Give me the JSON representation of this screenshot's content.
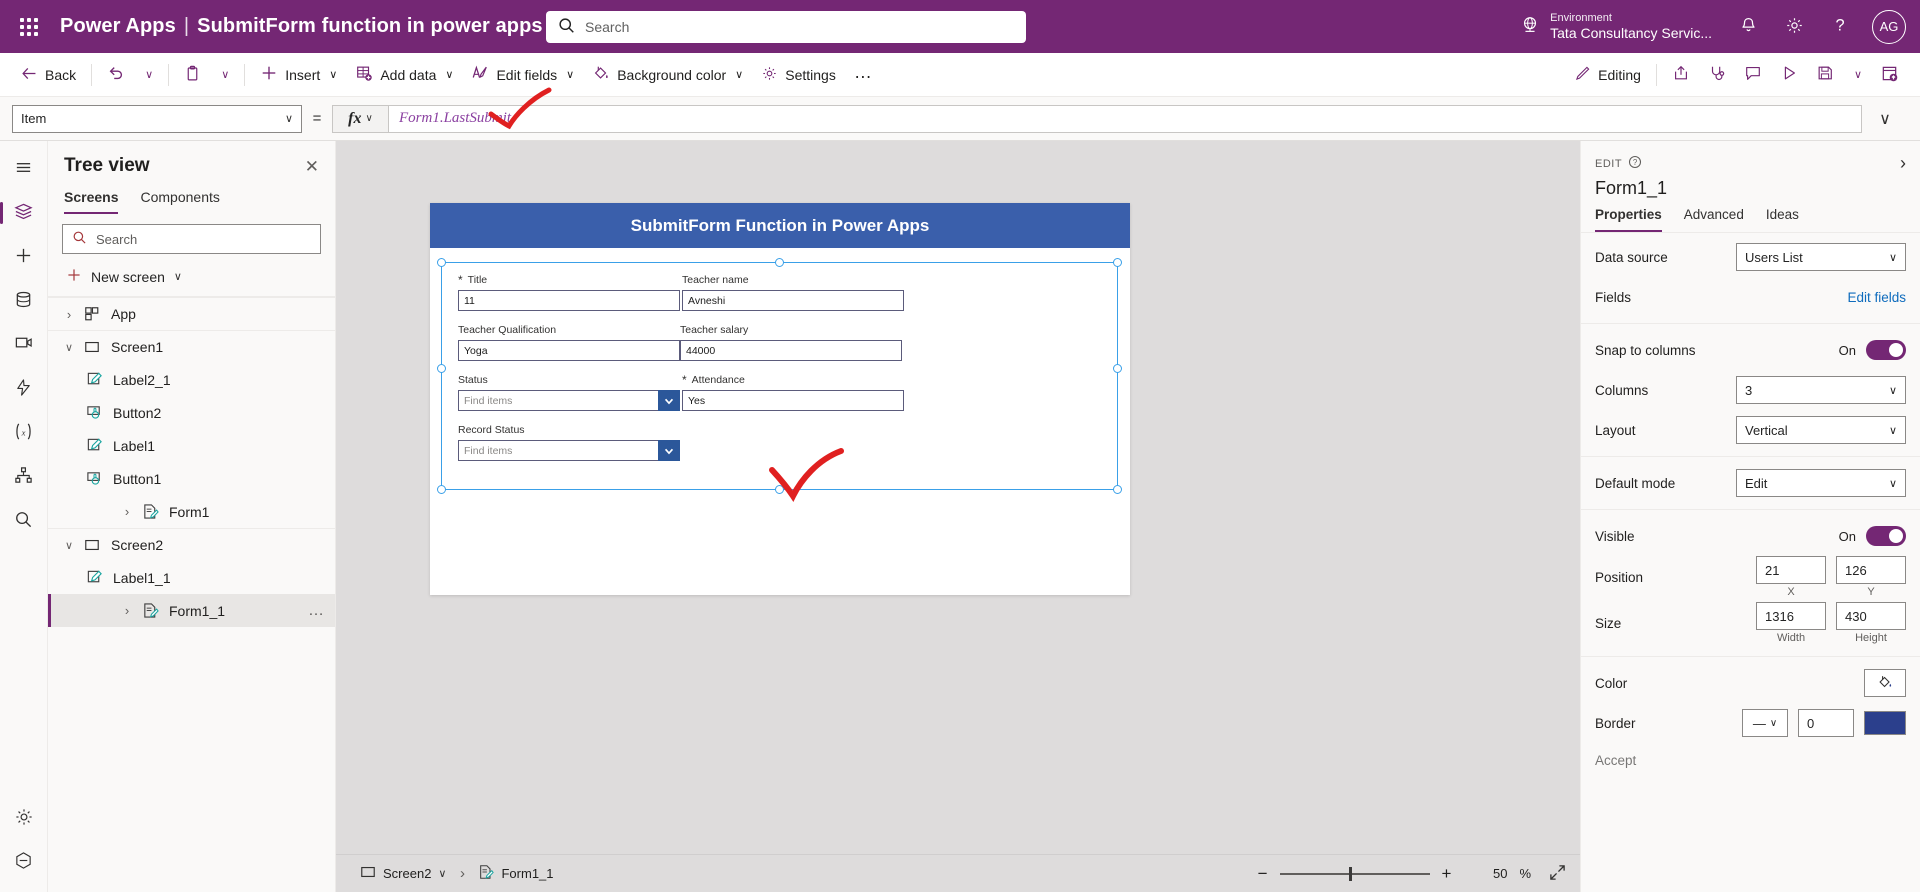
{
  "topbar": {
    "waffle_label": "App launcher",
    "brand": "Power Apps",
    "separator": "|",
    "doc_title": "SubmitForm function in power apps",
    "search_placeholder": "Search",
    "environment_label": "Environment",
    "environment_value": "Tata Consultancy Servic...",
    "notifications_label": "Notifications",
    "settings_label": "Settings",
    "help_label": "Help",
    "avatar_initials": "AG"
  },
  "commandbar": {
    "back": "Back",
    "undo": "Undo",
    "undo_chevron": "∨",
    "paste": "Paste",
    "paste_chevron": "∨",
    "insert": "Insert",
    "insert_chevron": "∨",
    "add_data": "Add data",
    "add_data_chevron": "∨",
    "edit_fields": "Edit fields",
    "edit_fields_chevron": "∨",
    "background_color": "Background color",
    "background_color_chevron": "∨",
    "settings": "Settings",
    "more": "…",
    "editing": "Editing",
    "share": "Share",
    "checker": "App checker",
    "comments": "Comments",
    "preview": "Preview the app",
    "save": "Save",
    "save_chevron": "∨",
    "publish": "Publish"
  },
  "formulabar": {
    "property_selected": "Item",
    "property_chevron": "∨",
    "equals": "=",
    "fx": "fx",
    "fx_chevron": "∨",
    "formula": "Form1.LastSubmit",
    "expand_chevron": "∨"
  },
  "rail": {
    "items": [
      {
        "name": "hamburger-icon",
        "label": "Menu"
      },
      {
        "name": "tree-view-icon",
        "label": "Tree view"
      },
      {
        "name": "insert-icon",
        "label": "Insert"
      },
      {
        "name": "data-icon",
        "label": "Data"
      },
      {
        "name": "media-icon",
        "label": "Media"
      },
      {
        "name": "power-automate-icon",
        "label": "Power Automate"
      },
      {
        "name": "variables-icon",
        "label": "Variables"
      },
      {
        "name": "components-icon",
        "label": "Components"
      },
      {
        "name": "search-icon",
        "label": "Search"
      },
      {
        "name": "app-settings-icon",
        "label": "Settings"
      },
      {
        "name": "advanced-tools-icon",
        "label": "Advanced tools"
      }
    ]
  },
  "treeview": {
    "title": "Tree view",
    "close_label": "Close",
    "tabs": [
      {
        "label": "Screens",
        "active": true
      },
      {
        "label": "Components",
        "active": false
      }
    ],
    "search_placeholder": "Search",
    "new_screen": "New screen",
    "new_screen_chevron": "∨",
    "items": [
      {
        "label": "App",
        "icon": "app-icon",
        "depth": 0,
        "twisty": "›",
        "selected": false,
        "group_top": true
      },
      {
        "label": "Screen1",
        "icon": "screen-icon",
        "depth": 0,
        "twisty": "∨",
        "selected": false,
        "group_top": true
      },
      {
        "label": "Label2_1",
        "icon": "label-icon",
        "depth": 2,
        "twisty": "",
        "selected": false
      },
      {
        "label": "Button2",
        "icon": "button-icon",
        "depth": 2,
        "twisty": "",
        "selected": false
      },
      {
        "label": "Label1",
        "icon": "label-icon",
        "depth": 2,
        "twisty": "",
        "selected": false
      },
      {
        "label": "Button1",
        "icon": "button-icon",
        "depth": 2,
        "twisty": "",
        "selected": false
      },
      {
        "label": "Form1",
        "icon": "form-icon",
        "depth": 1,
        "twisty": "›",
        "selected": false
      },
      {
        "label": "Screen2",
        "icon": "screen-icon",
        "depth": 0,
        "twisty": "∨",
        "selected": false
      },
      {
        "label": "Label1_1",
        "icon": "label-icon",
        "depth": 2,
        "twisty": "",
        "selected": false
      },
      {
        "label": "Form1_1",
        "icon": "form-icon",
        "depth": 1,
        "twisty": "›",
        "selected": true,
        "dots": "…"
      }
    ]
  },
  "canvas": {
    "app_title": "SubmitForm Function in Power Apps",
    "title_bg": "#3a5fab",
    "selection_color": "#3aa0e8",
    "annotation_color": "#e02020",
    "fields": [
      {
        "label": "Title",
        "required": true,
        "type": "text",
        "value": "11"
      },
      {
        "label": "Teacher name",
        "required": false,
        "type": "text",
        "value": "Avneshi"
      },
      {
        "label": "Teacher Qualification",
        "required": false,
        "type": "text",
        "value": "Yoga"
      },
      {
        "label": "Teacher salary",
        "required": false,
        "type": "text",
        "value": "44000"
      },
      {
        "label": "Status",
        "required": false,
        "type": "combo",
        "value": "Find items"
      },
      {
        "label": "Attendance",
        "required": true,
        "type": "text",
        "value": "Yes"
      },
      {
        "label": "Record Status",
        "required": false,
        "type": "combo",
        "value": "Find items"
      }
    ]
  },
  "statusbar": {
    "screen_name": "Screen2",
    "screen_chevron": "∨",
    "breadcrumb_sep": "›",
    "control_name": "Form1_1",
    "zoom_out": "−",
    "zoom_in": "+",
    "zoom_value": "50",
    "zoom_unit": "%",
    "fit_label": "Fit to window"
  },
  "properties": {
    "edit_label": "EDIT",
    "help_label": "?",
    "expand_label": "›",
    "control_name": "Form1_1",
    "tabs": [
      {
        "label": "Properties",
        "active": true
      },
      {
        "label": "Advanced",
        "active": false
      },
      {
        "label": "Ideas",
        "active": false
      }
    ],
    "rows": {
      "data_source_label": "Data source",
      "data_source_value": "Users List",
      "fields_label": "Fields",
      "fields_action": "Edit fields",
      "snap_label": "Snap to columns",
      "snap_state": "On",
      "columns_label": "Columns",
      "columns_value": "3",
      "layout_label": "Layout",
      "layout_value": "Vertical",
      "default_mode_label": "Default mode",
      "default_mode_value": "Edit",
      "visible_label": "Visible",
      "visible_state": "On",
      "position_label": "Position",
      "position_x": "21",
      "position_y": "126",
      "position_x_caption": "X",
      "position_y_caption": "Y",
      "size_label": "Size",
      "size_width": "1316",
      "size_height": "430",
      "size_width_caption": "Width",
      "size_height_caption": "Height",
      "color_label": "Color",
      "border_label": "Border",
      "border_style": "—",
      "border_chevron": "∨",
      "border_width": "0",
      "border_color_hex": "#2b3f8c",
      "accept_label": "Accept"
    },
    "chevron": "∨"
  },
  "colors": {
    "brand_purple": "#742774",
    "accent_blue": "#3a5fab",
    "link_blue": "#0f6cbd"
  }
}
